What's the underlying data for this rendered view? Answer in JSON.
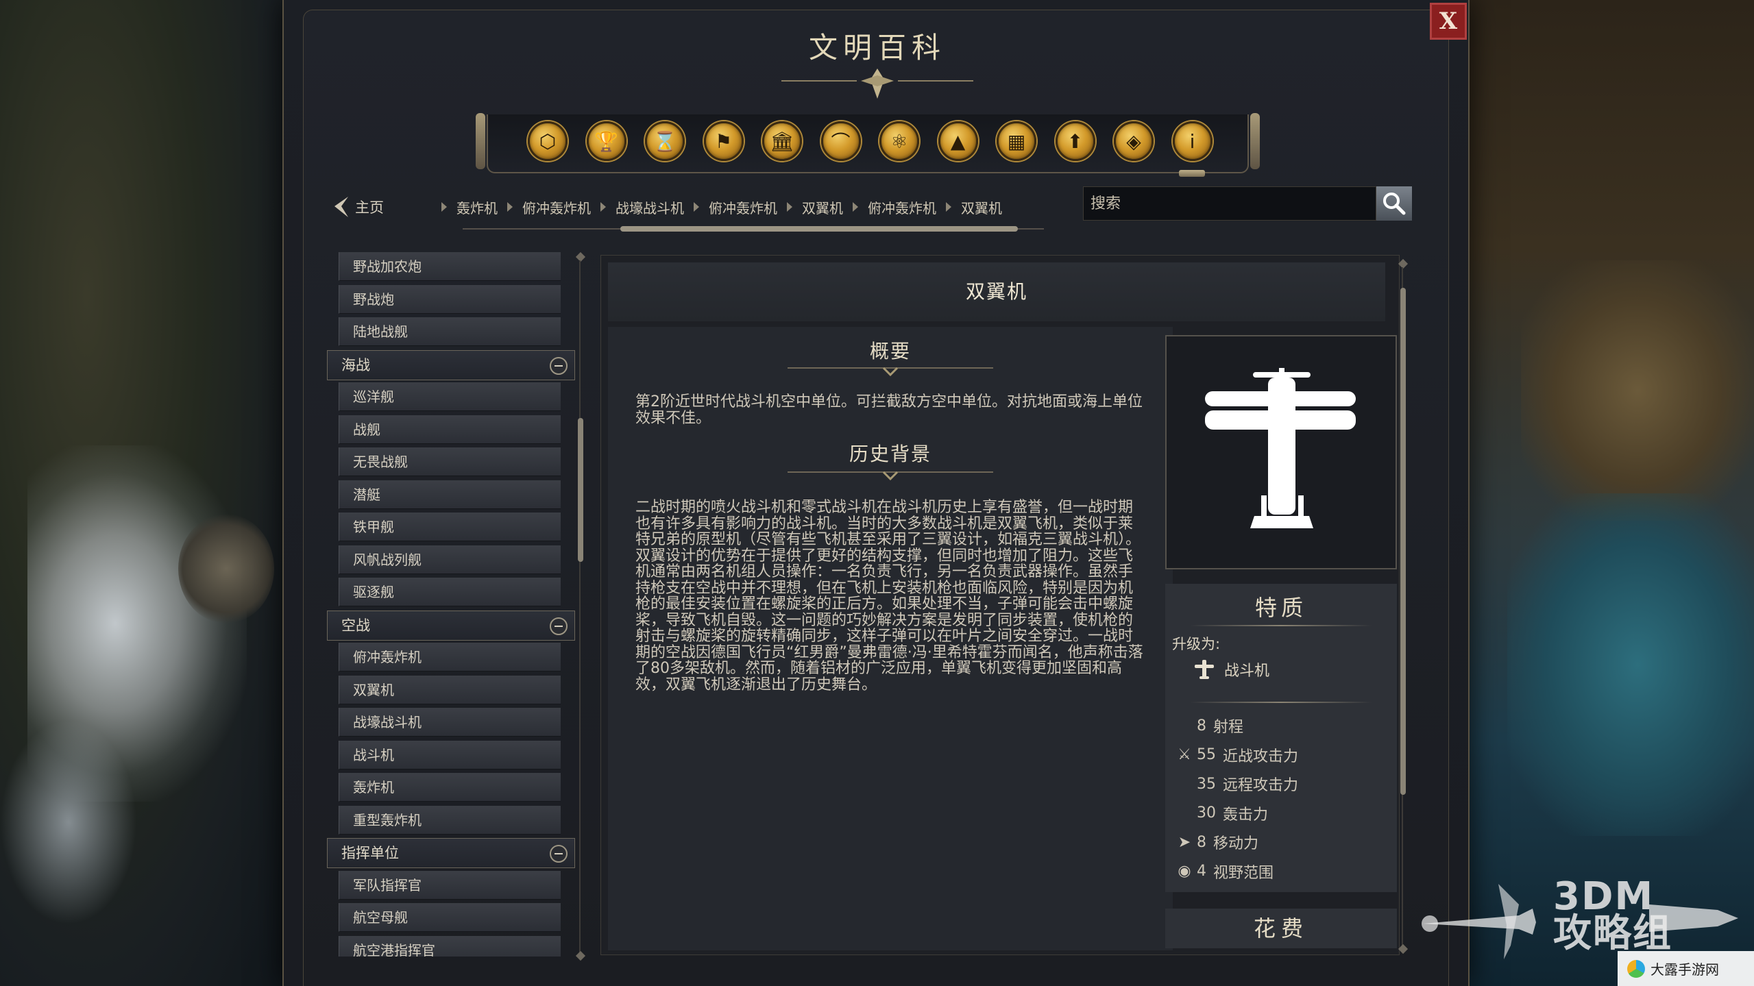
{
  "window": {
    "title": "文明百科",
    "close_label": "X"
  },
  "categories": [
    {
      "icon": "units-cube-icon",
      "glyph": "⬡"
    },
    {
      "icon": "goblet-icon",
      "glyph": "🏆"
    },
    {
      "icon": "hourglass-icon",
      "glyph": "⌛"
    },
    {
      "icon": "flag-icon",
      "glyph": "⚑"
    },
    {
      "icon": "building-icon",
      "glyph": "🏛"
    },
    {
      "icon": "dome-icon",
      "glyph": "⌒"
    },
    {
      "icon": "atom-icon",
      "glyph": "⚛"
    },
    {
      "icon": "mountain-icon",
      "glyph": "▲"
    },
    {
      "icon": "tower-icon",
      "glyph": "▦"
    },
    {
      "icon": "upgrade-arrow-icon",
      "glyph": "⬆"
    },
    {
      "icon": "book-icon",
      "glyph": "◈"
    },
    {
      "icon": "info-icon",
      "glyph": "i"
    }
  ],
  "nav": {
    "home_label": "主页",
    "breadcrumbs": [
      "轰炸机",
      "俯冲轰炸机",
      "战壕战斗机",
      "俯冲轰炸机",
      "双翼机",
      "俯冲轰炸机",
      "双翼机"
    ]
  },
  "search": {
    "placeholder": "搜索"
  },
  "sidebar": {
    "items": [
      {
        "type": "item",
        "label": "野战加农炮"
      },
      {
        "type": "item",
        "label": "野战炮"
      },
      {
        "type": "item",
        "label": "陆地战舰"
      },
      {
        "type": "group",
        "label": "海战"
      },
      {
        "type": "item",
        "label": "巡洋舰"
      },
      {
        "type": "item",
        "label": "战舰"
      },
      {
        "type": "item",
        "label": "无畏战舰"
      },
      {
        "type": "item",
        "label": "潜艇"
      },
      {
        "type": "item",
        "label": "铁甲舰"
      },
      {
        "type": "item",
        "label": "风帆战列舰"
      },
      {
        "type": "item",
        "label": "驱逐舰"
      },
      {
        "type": "group",
        "label": "空战"
      },
      {
        "type": "item",
        "label": "俯冲轰炸机"
      },
      {
        "type": "item",
        "label": "双翼机"
      },
      {
        "type": "item",
        "label": "战壕战斗机"
      },
      {
        "type": "item",
        "label": "战斗机"
      },
      {
        "type": "item",
        "label": "轰炸机"
      },
      {
        "type": "item",
        "label": "重型轰炸机"
      },
      {
        "type": "group",
        "label": "指挥单位"
      },
      {
        "type": "item",
        "label": "军队指挥官"
      },
      {
        "type": "item",
        "label": "航空母舰"
      },
      {
        "type": "item",
        "label": "航空港指挥官"
      }
    ]
  },
  "article": {
    "title": "双翼机",
    "overview_title": "概要",
    "overview_text": "第2阶近世时代战斗机空中单位。可拦截敌方空中单位。对抗地面或海上单位效果不佳。",
    "history_title": "历史背景",
    "history_text": "二战时期的喷火战斗机和零式战斗机在战斗机历史上享有盛誉，但一战时期也有许多具有影响力的战斗机。当时的大多数战斗机是双翼飞机，类似于莱特兄弟的原型机（尽管有些飞机甚至采用了三翼设计，如福克三翼战斗机）。双翼设计的优势在于提供了更好的结构支撑，但同时也增加了阻力。这些飞机通常由两名机组人员操作：一名负责飞行，另一名负责武器操作。虽然手持枪支在空战中并不理想，但在飞机上安装机枪也面临风险，特别是因为机枪的最佳安装位置在螺旋桨的正后方。如果处理不当，子弹可能会击中螺旋桨，导致飞机自毁。这一问题的巧妙解决方案是发明了同步装置，使机枪的射击与螺旋桨的旋转精确同步，这样子弹可以在叶片之间安全穿过。一战时期的空战因德国飞行员“红男爵”曼弗雷德·冯·里希特霍芬而闻名，他声称击落了80多架敌机。然而，随着铝材的广泛应用，单翼飞机变得更加坚固和高效，双翼飞机逐渐退出了历史舞台。"
  },
  "traits": {
    "title": "特质",
    "upgrade_label": "升级为:",
    "upgrade_unit": "战斗机",
    "stats": [
      {
        "icon": "",
        "value": "8",
        "label": "射程"
      },
      {
        "icon": "sword-icon",
        "value": "55",
        "label": "近战攻击力"
      },
      {
        "icon": "",
        "value": "35",
        "label": "远程攻击力"
      },
      {
        "icon": "",
        "value": "30",
        "label": "轰击力"
      },
      {
        "icon": "move-arrow-icon",
        "value": "8",
        "label": "移动力"
      },
      {
        "icon": "eye-icon",
        "value": "4",
        "label": "视野范围"
      }
    ]
  },
  "cost": {
    "title": "花费"
  },
  "watermarks": {
    "main": "3DM\n攻略组",
    "corner": "大露手游网"
  }
}
